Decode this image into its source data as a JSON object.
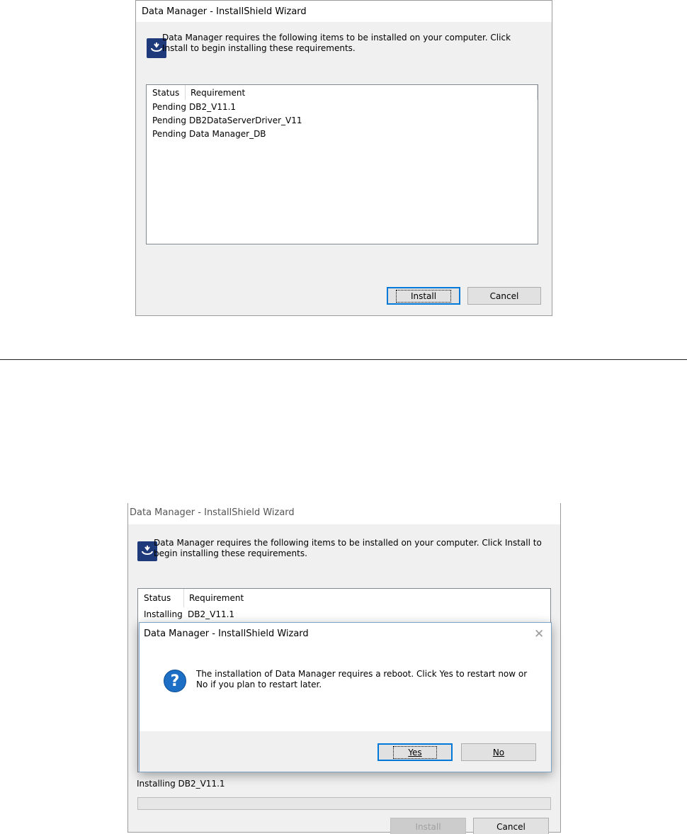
{
  "top_dialog": {
    "title": "Data Manager - InstallShield Wizard",
    "message": "Data Manager requires the following items to be installed on your computer. Click Install to begin installing these requirements.",
    "columns": [
      "Status",
      "Requirement"
    ],
    "rows": [
      {
        "status": "Pending",
        "requirement": "DB2_V11.1"
      },
      {
        "status": "Pending",
        "requirement": "DB2DataServerDriver_V11"
      },
      {
        "status": "Pending",
        "requirement": "Data Manager_DB"
      }
    ],
    "install_label": "Install",
    "cancel_label": "Cancel"
  },
  "bottom_dialog": {
    "title": "Data Manager - InstallShield Wizard",
    "message": "Data Manager requires the following items to be installed on your computer. Click Install to begin installing these requirements.",
    "columns": [
      "Status",
      "Requirement"
    ],
    "first_row": {
      "status": "Installing",
      "requirement": "DB2_V11.1"
    },
    "status_text": "Installing DB2_V11.1",
    "install_label": "Install",
    "cancel_label": "Cancel"
  },
  "message_box": {
    "title": "Data Manager - InstallShield Wizard",
    "message": "The installation of Data Manager requires a reboot.  Click Yes to restart now or No if you plan to restart later.",
    "yes_label": "Yes",
    "no_label": "No",
    "close_glyph": "✕",
    "question_glyph": "?"
  },
  "icons": [
    "installshield-icon",
    "question-icon",
    "close-icon"
  ],
  "colors": {
    "dialog_bg": "#f0f0f0",
    "accent": "#0078d7",
    "icon_blue": "#1f3a7a"
  }
}
